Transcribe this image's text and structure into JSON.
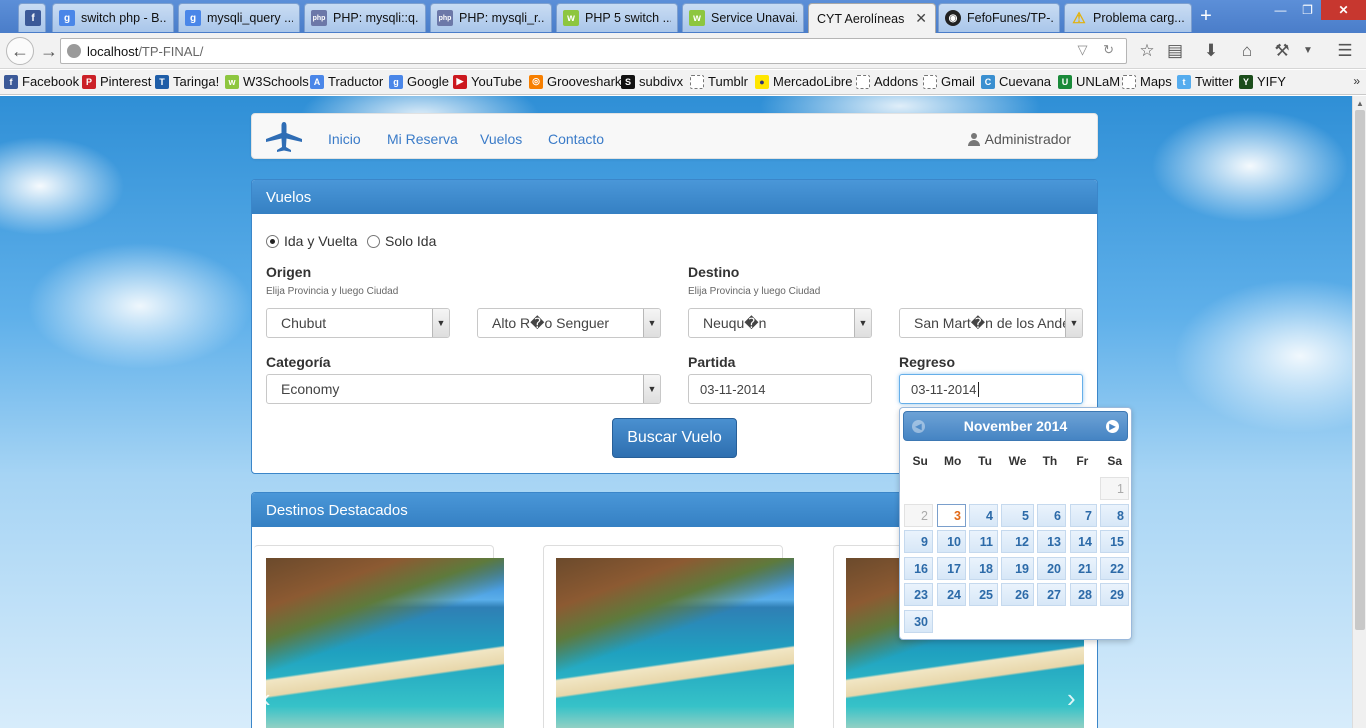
{
  "browser": {
    "tabs": [
      {
        "title": "",
        "icon": "facebook-icon",
        "color": "#3b5998"
      },
      {
        "title": "switch php - B...",
        "icon": "google-icon",
        "color": "#4a86e8"
      },
      {
        "title": "mysqli_query ...",
        "icon": "google-icon",
        "color": "#4a86e8"
      },
      {
        "title": "PHP: mysqli::q...",
        "icon": "php-icon",
        "color": "#6c78a8"
      },
      {
        "title": "PHP: mysqli_r...",
        "icon": "php-icon",
        "color": "#6c78a8"
      },
      {
        "title": "PHP 5 switch ...",
        "icon": "w3schools-icon",
        "color": "#8dc63f"
      },
      {
        "title": "Service Unavai...",
        "icon": "w3schools-icon",
        "color": "#8dc63f"
      },
      {
        "title": "CYT Aerolíneas",
        "icon": "",
        "color": "",
        "active": true
      },
      {
        "title": "FefoFunes/TP-...",
        "icon": "github-icon",
        "color": "#222222"
      },
      {
        "title": "Problema carg...",
        "icon": "warning-icon",
        "color": "#e2b10b"
      }
    ],
    "url_host": "localhost",
    "url_path": "/TP-FINAL/",
    "bookmarks": [
      {
        "label": "Facebook",
        "icon": "facebook-icon",
        "color": "#3b5998"
      },
      {
        "label": "Pinterest",
        "icon": "pinterest-icon",
        "color": "#cb2027"
      },
      {
        "label": "Taringa!",
        "icon": "taringa-icon",
        "color": "#1f5ea8"
      },
      {
        "label": "W3Schools",
        "icon": "w3schools-icon",
        "color": "#8dc63f"
      },
      {
        "label": "Traductor",
        "icon": "translate-icon",
        "color": "#4a86e8"
      },
      {
        "label": "Google",
        "icon": "google-icon",
        "color": "#4a86e8"
      },
      {
        "label": "YouTube",
        "icon": "youtube-icon",
        "color": "#cc181e"
      },
      {
        "label": "Grooveshark",
        "icon": "grooveshark-icon",
        "color": "#f77f00"
      },
      {
        "label": "subdivx",
        "icon": "subdivx-icon",
        "color": "#111111"
      },
      {
        "label": "Tumblr",
        "icon": "folder-icon",
        "color": ""
      },
      {
        "label": "MercadoLibre",
        "icon": "mercadolibre-icon",
        "color": "#ffe600"
      },
      {
        "label": "Addons",
        "icon": "folder-icon",
        "color": ""
      },
      {
        "label": "Gmail",
        "icon": "folder-icon",
        "color": ""
      },
      {
        "label": "Cuevana",
        "icon": "cuevana-icon",
        "color": "#3a8fd0"
      },
      {
        "label": "UNLaM",
        "icon": "unlam-icon",
        "color": "#1a8a3a"
      },
      {
        "label": "Maps",
        "icon": "folder-icon",
        "color": ""
      },
      {
        "label": "Twitter",
        "icon": "twitter-icon",
        "color": "#55acee"
      },
      {
        "label": "YIFY",
        "icon": "yify-icon",
        "color": "#1b4d1b"
      }
    ]
  },
  "site": {
    "nav": [
      "Inicio",
      "Mi Reserva",
      "Vuelos",
      "Contacto"
    ],
    "user": "Administrador",
    "accent": "#3a7bc8"
  },
  "vuelos": {
    "title": "Vuelos",
    "trip_options": [
      "Ida y Vuelta",
      "Solo Ida"
    ],
    "trip_selected": "Ida y Vuelta",
    "origen_label": "Origen",
    "origen_hint": "Elija Provincia y luego Ciudad",
    "origen_provincia": "Chubut",
    "origen_ciudad": "Alto R�o Senguer",
    "destino_label": "Destino",
    "destino_hint": "Elija Provincia y luego Ciudad",
    "destino_provincia": "Neuqu�n",
    "destino_ciudad": "San Mart�n de los Andes",
    "categoria_label": "Categoría",
    "categoria_value": "Economy",
    "partida_label": "Partida",
    "partida_value": "03-11-2014",
    "regreso_label": "Regreso",
    "regreso_value": "03-11-2014",
    "buscar_label": "Buscar Vuelo"
  },
  "destinos": {
    "title": "Destacados",
    "title_prefix": "Destinos",
    "prev": "‹",
    "next": "›"
  },
  "datepicker": {
    "month_label": "November 2014",
    "weekdays": [
      "Su",
      "Mo",
      "Tu",
      "We",
      "Th",
      "Fr",
      "Sa"
    ],
    "weeks": [
      [
        null,
        null,
        null,
        null,
        null,
        null,
        1
      ],
      [
        2,
        3,
        4,
        5,
        6,
        7,
        8
      ],
      [
        9,
        10,
        11,
        12,
        13,
        14,
        15
      ],
      [
        16,
        17,
        18,
        19,
        20,
        21,
        22
      ],
      [
        23,
        24,
        25,
        26,
        27,
        28,
        29
      ],
      [
        30,
        null,
        null,
        null,
        null,
        null,
        null
      ]
    ],
    "disabled_days": [
      1,
      2
    ],
    "today": 3
  }
}
